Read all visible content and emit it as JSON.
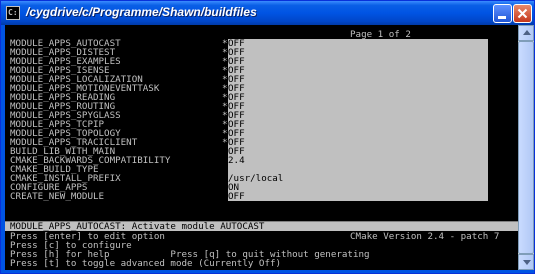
{
  "window": {
    "title": "/cygdrive/c/Programme/Shawn/buildfiles",
    "minimize_label": "_",
    "close_label": "X"
  },
  "console": {
    "page_label": "Page 1 of 2",
    "options": [
      {
        "name": "MODULE_APPS_AUTOCAST",
        "star": "*",
        "value": "OFF"
      },
      {
        "name": "MODULE_APPS_DISTEST",
        "star": "*",
        "value": "OFF"
      },
      {
        "name": "MODULE_APPS_EXAMPLES",
        "star": "*",
        "value": "OFF"
      },
      {
        "name": "MODULE_APPS_ISENSE",
        "star": "*",
        "value": "OFF"
      },
      {
        "name": "MODULE_APPS_LOCALIZATION",
        "star": "*",
        "value": "OFF"
      },
      {
        "name": "MODULE_APPS_MOTIONEVENTTASK",
        "star": "*",
        "value": "OFF"
      },
      {
        "name": "MODULE_APPS_READING",
        "star": "*",
        "value": "OFF"
      },
      {
        "name": "MODULE_APPS_ROUTING",
        "star": "*",
        "value": "OFF"
      },
      {
        "name": "MODULE_APPS_SPYGLASS",
        "star": "*",
        "value": "OFF"
      },
      {
        "name": "MODULE_APPS_TCPIP",
        "star": "*",
        "value": "OFF"
      },
      {
        "name": "MODULE_APPS_TOPOLOGY",
        "star": "*",
        "value": "OFF"
      },
      {
        "name": "MODULE_APPS_TRACICLIENT",
        "star": "*",
        "value": "OFF"
      },
      {
        "name": "BUILD_LIB_WITH_MAIN",
        "star": "",
        "value": "OFF"
      },
      {
        "name": "CMAKE_BACKWARDS_COMPATIBILITY",
        "star": "",
        "value": "2.4"
      },
      {
        "name": "CMAKE_BUILD_TYPE",
        "star": "",
        "value": ""
      },
      {
        "name": "CMAKE_INSTALL_PREFIX",
        "star": "",
        "value": "/usr/local"
      },
      {
        "name": "CONFIGURE_APPS",
        "star": "",
        "value": "ON"
      },
      {
        "name": "CREATE_NEW_MODULE",
        "star": "",
        "value": "OFF"
      }
    ],
    "status": "MODULE_APPS_AUTOCAST: Activate module AUTOCAST",
    "help_lines": [
      "Press [enter] to edit option",
      "Press [c] to configure",
      "Press [h] for help           Press [q] to quit without generating",
      "Press [t] to toggle advanced mode (Currently Off)"
    ],
    "cmake_version": "CMake Version 2.4 - patch 7"
  },
  "colors": {
    "titlebar": "#0054e3",
    "console_bg": "#000000",
    "console_fg": "#c0c0c0",
    "value_bg": "#c0c0c0"
  }
}
